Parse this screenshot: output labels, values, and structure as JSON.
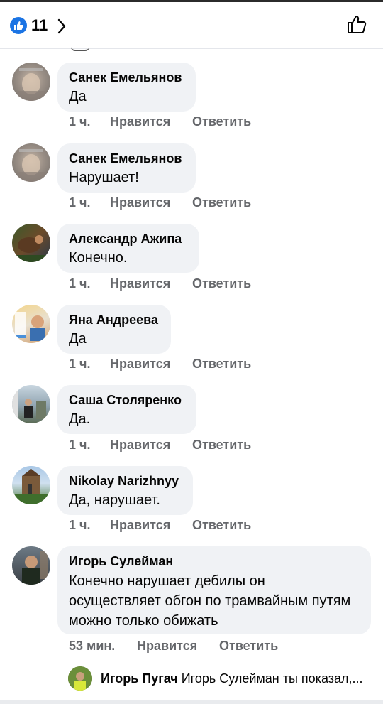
{
  "header": {
    "like_count": "11",
    "icons": {
      "like_badge": "like-reaction-icon",
      "chevron": "chevron-right-icon",
      "thumb": "thumbs-up-outline-icon"
    }
  },
  "comments": [
    {
      "author": "Санек Емельянов",
      "text": "Да",
      "time": "1 ч.",
      "like_label": "Нравится",
      "reply_label": "Ответить"
    },
    {
      "author": "Санек Емельянов",
      "text": "Нарушает!",
      "time": "1 ч.",
      "like_label": "Нравится",
      "reply_label": "Ответить"
    },
    {
      "author": "Александр Ажипа",
      "text": "Конечно.",
      "time": "1 ч.",
      "like_label": "Нравится",
      "reply_label": "Ответить"
    },
    {
      "author": "Яна Андреева",
      "text": "Да",
      "time": "1 ч.",
      "like_label": "Нравится",
      "reply_label": "Ответить"
    },
    {
      "author": "Саша Столяренко",
      "text": "Да.",
      "time": "1 ч.",
      "like_label": "Нравится",
      "reply_label": "Ответить"
    },
    {
      "author": "Nikolay Narizhnyy",
      "text": "Да, нарушает.",
      "time": "1 ч.",
      "like_label": "Нравится",
      "reply_label": "Ответить"
    },
    {
      "author": "Игорь Сулейман",
      "text": "Конечно нарушает дебилы он осуществляет обгон по трамвайным путям можно только обижать",
      "time": "53 мин.",
      "like_label": "Нравится",
      "reply_label": "Ответить"
    }
  ],
  "reply_preview": {
    "author": "Игорь Пугач",
    "text": "Игорь Сулейман ты показал,..."
  },
  "colors": {
    "accent": "#1b74e4",
    "bubble": "#f0f2f5",
    "meta": "#65676b",
    "text": "#050505"
  }
}
